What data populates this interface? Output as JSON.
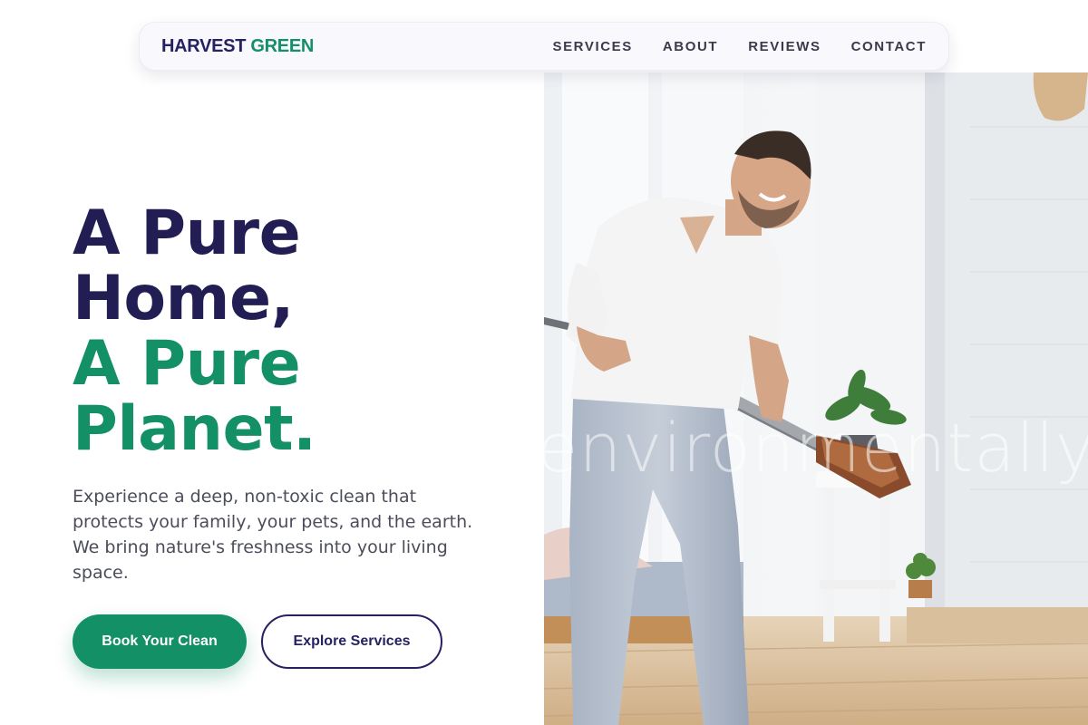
{
  "brand": {
    "part1": "HARVEST",
    "part2": "GREEN"
  },
  "nav": [
    {
      "label": "SERVICES"
    },
    {
      "label": "ABOUT"
    },
    {
      "label": "REVIEWS"
    },
    {
      "label": "CONTACT"
    }
  ],
  "hero": {
    "headline_line1": "A Pure",
    "headline_line2": "Home,",
    "headline_line3": "A Pure",
    "headline_line4": "Planet.",
    "description": "Experience a deep, non-toxic clean that protects your family, your pets, and the earth. We bring nature's freshness into your living space.",
    "primary_cta": "Book Your Clean",
    "secondary_cta": "Explore Services",
    "image_watermark": "environmentally.lov"
  },
  "colors": {
    "brand_dark": "#262261",
    "brand_green": "#139066",
    "body_text": "#4b4e5a"
  },
  "icons": {
    "hero_image": "man-vacuuming-photo"
  }
}
